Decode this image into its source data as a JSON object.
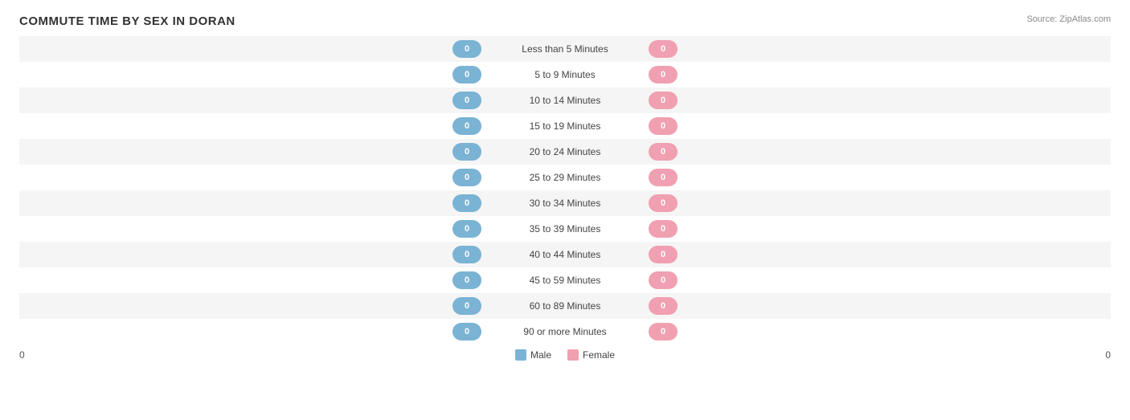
{
  "title": "COMMUTE TIME BY SEX IN DORAN",
  "source": "Source: ZipAtlas.com",
  "axis": {
    "left_label": "0",
    "right_label": "0"
  },
  "legend": {
    "male_label": "Male",
    "female_label": "Female"
  },
  "rows": [
    {
      "label": "Less than 5 Minutes",
      "male": "0",
      "female": "0"
    },
    {
      "label": "5 to 9 Minutes",
      "male": "0",
      "female": "0"
    },
    {
      "label": "10 to 14 Minutes",
      "male": "0",
      "female": "0"
    },
    {
      "label": "15 to 19 Minutes",
      "male": "0",
      "female": "0"
    },
    {
      "label": "20 to 24 Minutes",
      "male": "0",
      "female": "0"
    },
    {
      "label": "25 to 29 Minutes",
      "male": "0",
      "female": "0"
    },
    {
      "label": "30 to 34 Minutes",
      "male": "0",
      "female": "0"
    },
    {
      "label": "35 to 39 Minutes",
      "male": "0",
      "female": "0"
    },
    {
      "label": "40 to 44 Minutes",
      "male": "0",
      "female": "0"
    },
    {
      "label": "45 to 59 Minutes",
      "male": "0",
      "female": "0"
    },
    {
      "label": "60 to 89 Minutes",
      "male": "0",
      "female": "0"
    },
    {
      "label": "90 or more Minutes",
      "male": "0",
      "female": "0"
    }
  ]
}
